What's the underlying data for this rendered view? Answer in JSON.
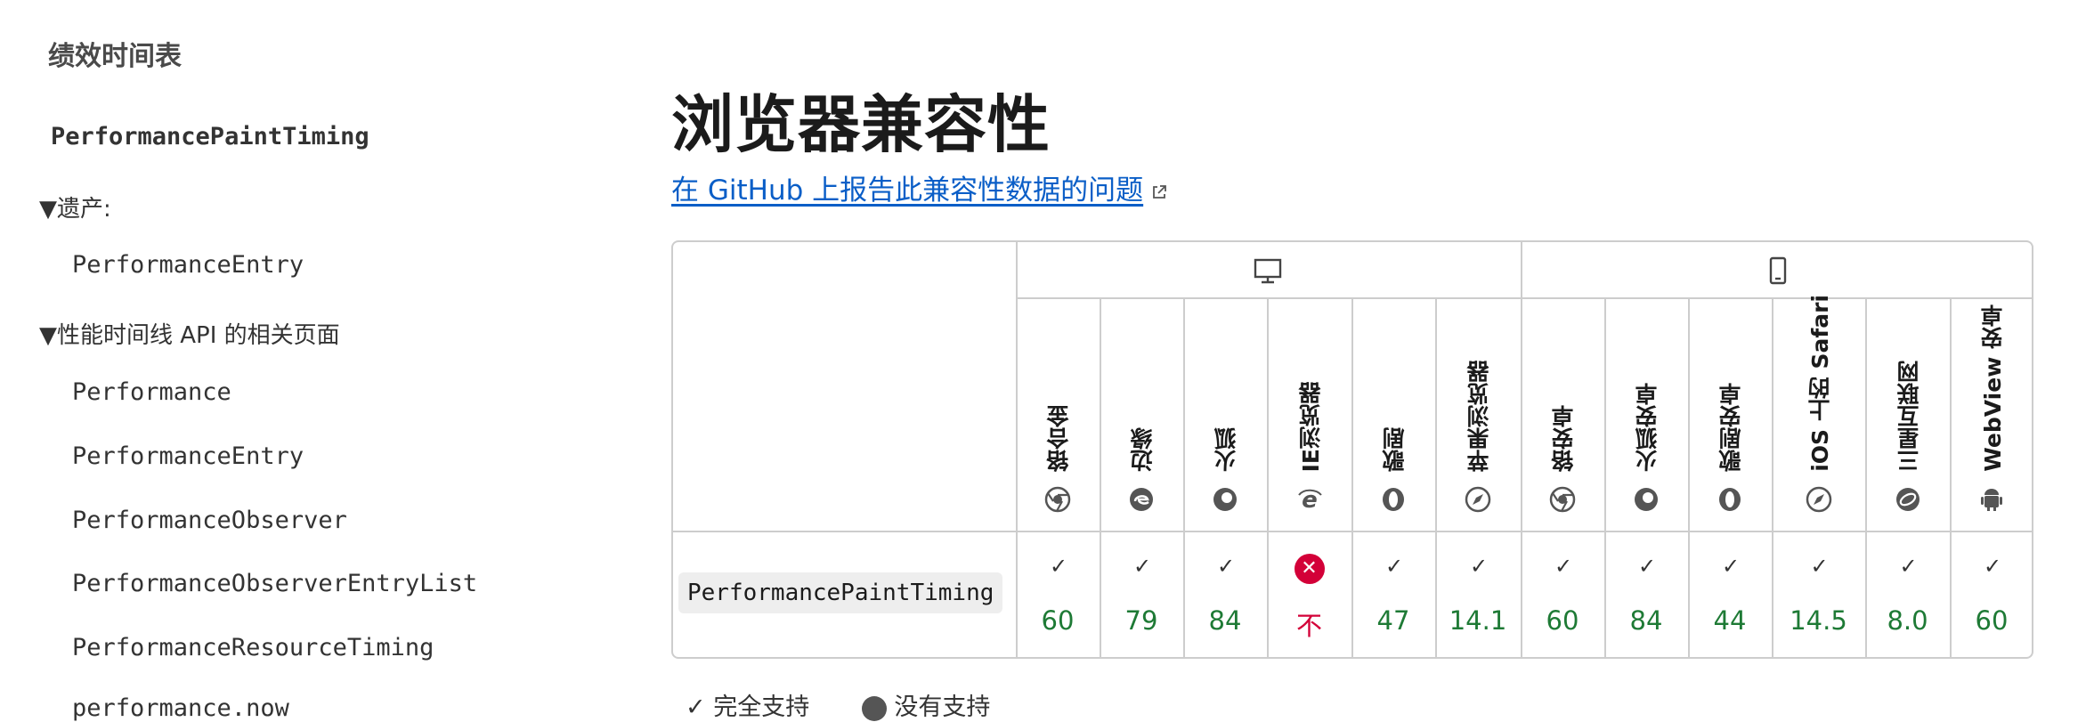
{
  "sidebar": {
    "title": "绩效时间表",
    "main_item": "PerformancePaintTiming",
    "section_inheritance": "▼遗产:",
    "inheritance_items": [
      "PerformanceEntry"
    ],
    "section_related": "▼性能时间线 API 的相关页面",
    "related_items": [
      "Performance",
      "PerformanceEntry",
      "PerformanceObserver",
      "PerformanceObserverEntryList",
      "PerformanceResourceTiming",
      "performance.now"
    ]
  },
  "main": {
    "heading": "浏览器兼容性",
    "github_link": "在 GitHub 上报告此兼容性数据的问题"
  },
  "compat": {
    "feature": "PerformancePaintTiming",
    "browsers": [
      {
        "name": "铬合金",
        "icon": "chrome-icon",
        "version": "60",
        "supported": true
      },
      {
        "name": "边缘",
        "icon": "edge-icon",
        "version": "79",
        "supported": true
      },
      {
        "name": "火狐",
        "icon": "firefox-icon",
        "version": "84",
        "supported": true
      },
      {
        "name": "IE浏览器",
        "icon": "ie-icon",
        "version": "不",
        "supported": false
      },
      {
        "name": "歌剧",
        "icon": "opera-icon",
        "version": "47",
        "supported": true
      },
      {
        "name": "苹果浏览器",
        "icon": "safari-icon",
        "version": "14.1",
        "supported": true
      },
      {
        "name": "铬安卓",
        "icon": "chrome-icon",
        "version": "60",
        "supported": true
      },
      {
        "name": "火狐安卓",
        "icon": "firefox-icon",
        "version": "84",
        "supported": true
      },
      {
        "name": "歌剧安卓",
        "icon": "opera-icon",
        "version": "44",
        "supported": true
      },
      {
        "name": "iOS 上的 Safari",
        "icon": "safari-icon",
        "version": "14.5",
        "supported": true
      },
      {
        "name": "三星互联网",
        "icon": "samsung-icon",
        "version": "8.0",
        "supported": true
      },
      {
        "name": "WebView 安卓",
        "icon": "android-icon",
        "version": "60",
        "supported": true
      }
    ],
    "groups": [
      {
        "icon": "desktop-icon"
      },
      {
        "icon": "mobile-icon"
      }
    ]
  },
  "legend": {
    "full_support": "完全支持",
    "no_support": "没有支持"
  },
  "colors": {
    "link": "#0a5ec7",
    "version_ok": "#1e7a35",
    "version_no": "#d30038"
  }
}
